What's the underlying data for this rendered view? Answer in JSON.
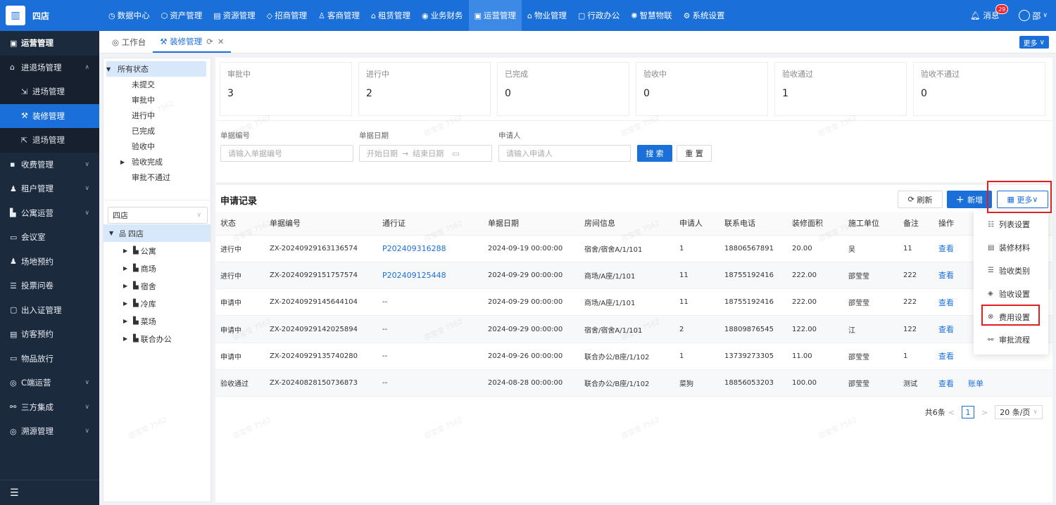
{
  "top": {
    "logo": "四店",
    "nav": [
      {
        "icon": "◷",
        "label": "数据中心"
      },
      {
        "icon": "⬡",
        "label": "资产管理"
      },
      {
        "icon": "▤",
        "label": "资源管理"
      },
      {
        "icon": "◇",
        "label": "招商管理"
      },
      {
        "icon": "♙",
        "label": "客商管理"
      },
      {
        "icon": "⌂",
        "label": "租赁管理"
      },
      {
        "icon": "◉",
        "label": "业务财务"
      },
      {
        "icon": "▣",
        "label": "运营管理"
      },
      {
        "icon": "⌂",
        "label": "物业管理"
      },
      {
        "icon": "▢",
        "label": "行政办公"
      },
      {
        "icon": "✺",
        "label": "智慧物联"
      },
      {
        "icon": "⚙",
        "label": "系统设置"
      }
    ],
    "message": "消息",
    "badge": "29",
    "user": "邵"
  },
  "sidebar": {
    "title": "运营管理",
    "group": "进退场管理",
    "subs": [
      "进场管理",
      "装修管理",
      "退场管理"
    ],
    "items": [
      "收费管理",
      "租户管理",
      "公寓运营",
      "会议室",
      "场地预约",
      "投票问卷",
      "出入证管理",
      "访客预约",
      "物品放行",
      "C端运营",
      "三方集成",
      "溯源管理"
    ]
  },
  "tabs": {
    "home": "工作台",
    "current": "装修管理",
    "more": "更多"
  },
  "status_tree": {
    "root": "所有状态",
    "items": [
      "未提交",
      "审批中",
      "进行中",
      "已完成",
      "验收中",
      "验收完成",
      "审批不通过"
    ]
  },
  "store_select": "四店",
  "store_tree": {
    "root": "四店",
    "items": [
      "公寓",
      "商场",
      "宿舍",
      "冷库",
      "菜场",
      "联合办公"
    ]
  },
  "stats": [
    {
      "label": "审批中",
      "value": "3"
    },
    {
      "label": "进行中",
      "value": "2"
    },
    {
      "label": "已完成",
      "value": "0"
    },
    {
      "label": "验收中",
      "value": "0"
    },
    {
      "label": "验收通过",
      "value": "1"
    },
    {
      "label": "验收不通过",
      "value": "0"
    }
  ],
  "search": {
    "code_label": "单据编号",
    "code_ph": "请输入单据编号",
    "date_label": "单据日期",
    "start_ph": "开始日期",
    "end_ph": "结束日期",
    "applicant_label": "申请人",
    "applicant_ph": "请输入申请人",
    "search_btn": "搜 索",
    "reset_btn": "重 置"
  },
  "records": {
    "title": "申请记录",
    "refresh": "刷新",
    "add": "新增",
    "more": "更多",
    "columns": [
      "状态",
      "单据编号",
      "通行证",
      "单据日期",
      "房间信息",
      "申请人",
      "联系电话",
      "装修面积",
      "施工单位",
      "备注",
      "操作"
    ],
    "rows": [
      [
        "进行中",
        "ZX-20240929163136574",
        "P202409316288",
        "2024-09-19 00:00:00",
        "宿舍/宿舍A/1/101",
        "1",
        "18806567891",
        "20.00",
        "吴",
        "11",
        "查看",
        ""
      ],
      [
        "进行中",
        "ZX-20240929151757574",
        "P202409125448",
        "2024-09-29 00:00:00",
        "商场/A座/1/101",
        "11",
        "18755192416",
        "222.00",
        "邵莹莹",
        "222",
        "查看",
        ""
      ],
      [
        "申请中",
        "ZX-20240929145644104",
        "--",
        "2024-09-29 00:00:00",
        "商场/A座/1/101",
        "11",
        "18755192416",
        "222.00",
        "邵莹莹",
        "222",
        "查看",
        ""
      ],
      [
        "申请中",
        "ZX-20240929142025894",
        "--",
        "2024-09-29 00:00:00",
        "宿舍/宿舍A/1/101",
        "2",
        "18809876545",
        "122.00",
        "江",
        "122",
        "查看",
        ""
      ],
      [
        "申请中",
        "ZX-20240929135740280",
        "--",
        "2024-09-26 00:00:00",
        "联合办公/B座/1/102",
        "1",
        "13739273305",
        "11.00",
        "邵莹莹",
        "1",
        "查看",
        ""
      ],
      [
        "验收通过",
        "ZX-20240828150736873",
        "--",
        "2024-08-28 00:00:00",
        "联合办公/B座/1/102",
        "菜狗",
        "18856053203",
        "100.00",
        "邵莹莹",
        "测试",
        "查看",
        "账单"
      ]
    ],
    "total": "共6条",
    "page": "1",
    "page_size": "20 条/页"
  },
  "dropdown": [
    {
      "icon": "☷",
      "label": "列表设置"
    },
    {
      "icon": "▤",
      "label": "装修材料"
    },
    {
      "icon": "☰",
      "label": "验收类别"
    },
    {
      "icon": "◈",
      "label": "验收设置"
    },
    {
      "icon": "⊗",
      "label": "费用设置"
    },
    {
      "icon": "⚯",
      "label": "审批流程"
    }
  ],
  "watermark": "邵莹莹 7562"
}
